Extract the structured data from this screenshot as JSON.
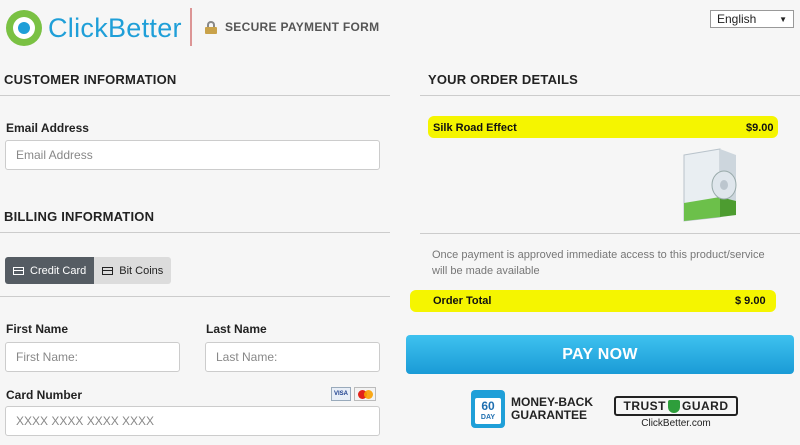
{
  "header": {
    "brand": "ClickBetter",
    "secure_label": "SECURE PAYMENT FORM",
    "language": "English",
    "language_arrow": "▼"
  },
  "customer": {
    "title": "CUSTOMER INFORMATION",
    "email_label": "Email Address",
    "email_placeholder": "Email Address"
  },
  "billing": {
    "title": "BILLING INFORMATION",
    "tabs": [
      {
        "label": "Credit Card",
        "active": true
      },
      {
        "label": "Bit Coins",
        "active": false
      }
    ],
    "first_name_label": "First Name",
    "first_name_placeholder": "First Name:",
    "last_name_label": "Last Name",
    "last_name_placeholder": "Last Name:",
    "card_number_label": "Card Number",
    "card_number_placeholder": "XXXX XXXX XXXX XXXX",
    "card_logos": [
      "VISA",
      "mastercard"
    ]
  },
  "order": {
    "title": "YOUR ORDER DETAILS",
    "item_name": "Silk Road Effect",
    "item_price": "$9.00",
    "note": "Once payment is approved immediate access to this product/service will be made available",
    "total_label": "Order Total",
    "total_value": "$ 9.00",
    "pay_label": "PAY NOW"
  },
  "badges": {
    "days": "60",
    "day_word": "DAY",
    "money_back_line1": "MONEY-BACK",
    "money_back_line2": "GUARANTEE",
    "trust_left": "TRUST",
    "trust_right": "GUARD",
    "trust_sub": "ClickBetter.com"
  },
  "colors": {
    "brand_blue": "#1f9fd8",
    "brand_green": "#7ac143",
    "highlight": "#f5f500",
    "pay_button": "#2bb0e6"
  }
}
